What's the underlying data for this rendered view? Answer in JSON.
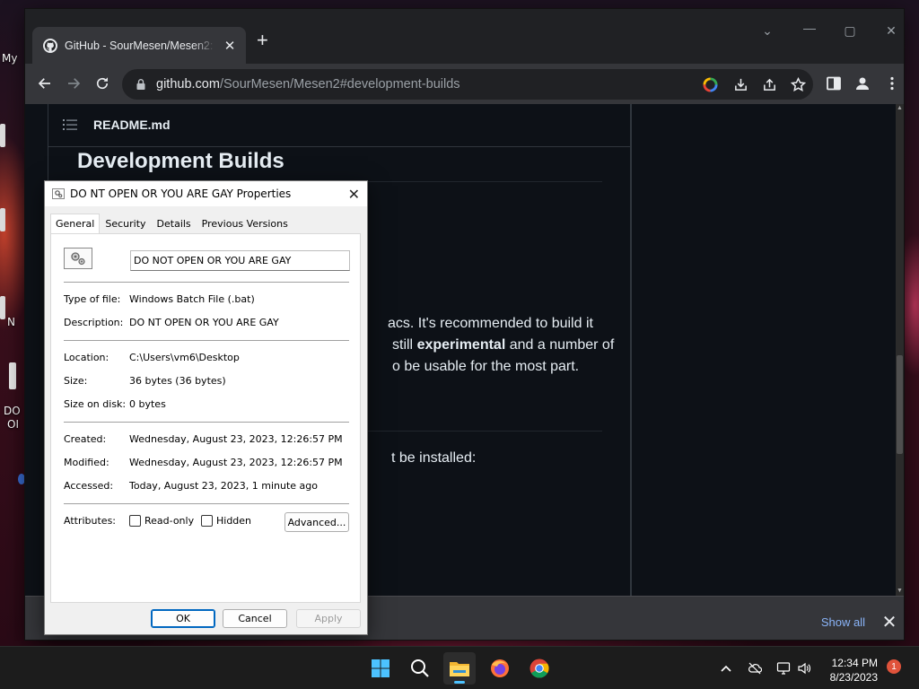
{
  "desktop": {
    "icon_labels": [
      "My",
      "N",
      "DO",
      "OI"
    ]
  },
  "browser": {
    "tab": {
      "title": "GitHub - SourMesen/Mesen2: M",
      "favicon": "github-icon"
    },
    "url": {
      "host": "github.com",
      "path": "/SourMesen/Mesen2#development-builds"
    },
    "readme": {
      "filename": "README.md",
      "heading": "Development Builds",
      "lines": [
        "acs. It's recommended to build it",
        "still",
        "experimental",
        "and a number of",
        "o be usable for the most part.",
        "t be installed:"
      ]
    },
    "download_bar": {
      "show_all": "Show all"
    }
  },
  "dialog": {
    "title": "DO NT OPEN OR YOU ARE GAY Properties",
    "tabs": [
      "General",
      "Security",
      "Details",
      "Previous Versions"
    ],
    "active_tab": "General",
    "name_value": "DO NOT OPEN OR YOU ARE GAY",
    "props": {
      "type_label": "Type of file:",
      "type_value": "Windows Batch File (.bat)",
      "desc_label": "Description:",
      "desc_value": "DO NT OPEN OR YOU ARE GAY",
      "location_label": "Location:",
      "location_value": "C:\\Users\\vm6\\Desktop",
      "size_label": "Size:",
      "size_value": "36 bytes (36 bytes)",
      "disk_label": "Size on disk:",
      "disk_value": "0 bytes",
      "created_label": "Created:",
      "created_value": "Wednesday, August 23, 2023, 12:26:57 PM",
      "modified_label": "Modified:",
      "modified_value": "Wednesday, August 23, 2023, 12:26:57 PM",
      "accessed_label": "Accessed:",
      "accessed_value": "Today, August 23, 2023, 1 minute ago",
      "attributes_label": "Attributes:"
    },
    "attributes": {
      "readonly": "Read-only",
      "readonly_checked": false,
      "hidden": "Hidden",
      "hidden_checked": false
    },
    "advanced_label": "Advanced...",
    "buttons": {
      "ok": "OK",
      "cancel": "Cancel",
      "apply": "Apply"
    }
  },
  "taskbar": {
    "apps": [
      "windows-start",
      "search",
      "file-explorer",
      "firefox",
      "chrome"
    ],
    "active_app": "file-explorer",
    "time": "12:34 PM",
    "date": "8/23/2023",
    "notification_count": "1"
  },
  "colors": {
    "github_bg": "#0d1117",
    "chrome_toolbar": "#35363a",
    "link_blue": "#8ab4f8",
    "taskbar_accent": "#4cc2ff"
  }
}
